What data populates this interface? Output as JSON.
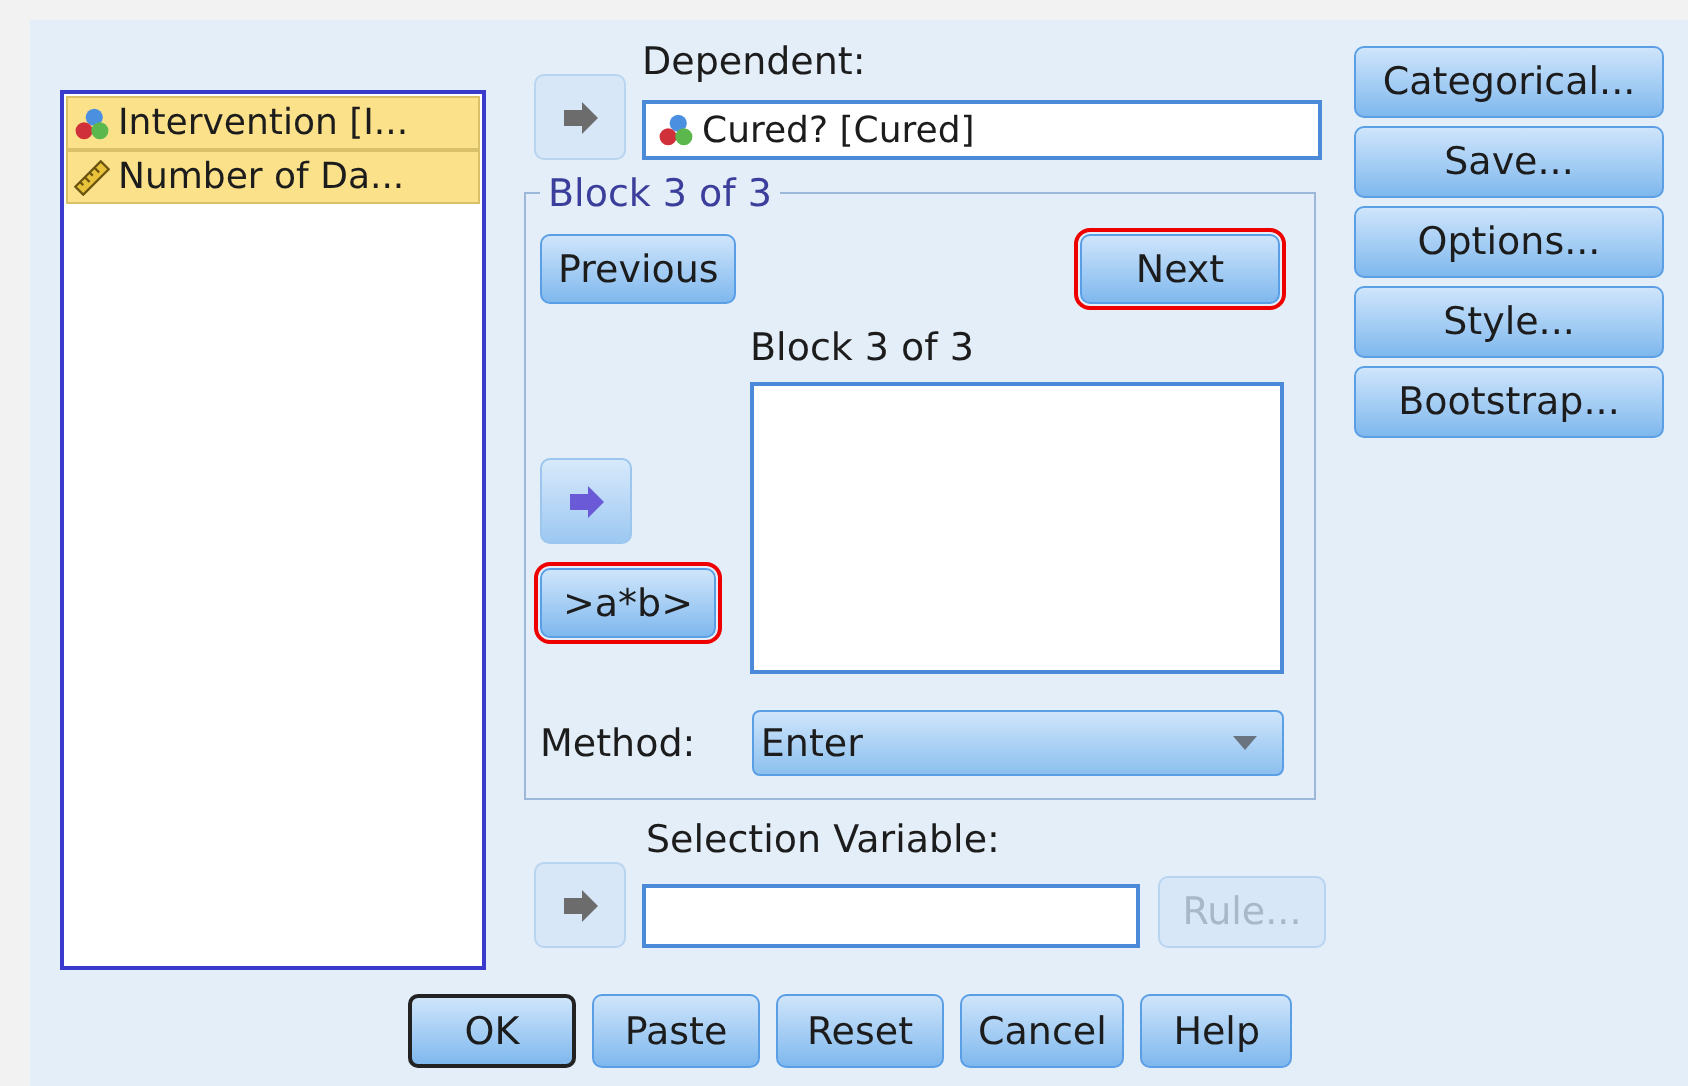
{
  "variables": [
    {
      "kind": "nominal",
      "label": "Intervention [I...",
      "selected": true
    },
    {
      "kind": "scale",
      "label": "Number of Da...",
      "selected": true
    }
  ],
  "dependent": {
    "label": "Dependent:",
    "arrow_enabled": false,
    "value": "Cured? [Cured]",
    "kind": "nominal"
  },
  "block": {
    "group_title": "Block 3 of 3",
    "previous": {
      "label": "Previous",
      "highlighted": false
    },
    "next": {
      "label": "Next",
      "highlighted": true
    },
    "list_label": "Block 3 of 3",
    "arrow_enabled": true,
    "interaction": {
      "label": ">a*b>",
      "highlighted": true
    },
    "method_label": "Method:",
    "method_value": "Enter"
  },
  "selection": {
    "label": "Selection Variable:",
    "arrow_enabled": false,
    "rule": {
      "label": "Rule...",
      "disabled": true
    }
  },
  "side_buttons": [
    {
      "label": "Categorical..."
    },
    {
      "label": "Save..."
    },
    {
      "label": "Options..."
    },
    {
      "label": "Style..."
    },
    {
      "label": "Bootstrap..."
    }
  ],
  "bottom_buttons": [
    {
      "label": "OK",
      "default": true
    },
    {
      "label": "Paste",
      "default": false
    },
    {
      "label": "Reset",
      "default": false
    },
    {
      "label": "Cancel",
      "default": false
    },
    {
      "label": "Help",
      "default": false
    }
  ]
}
